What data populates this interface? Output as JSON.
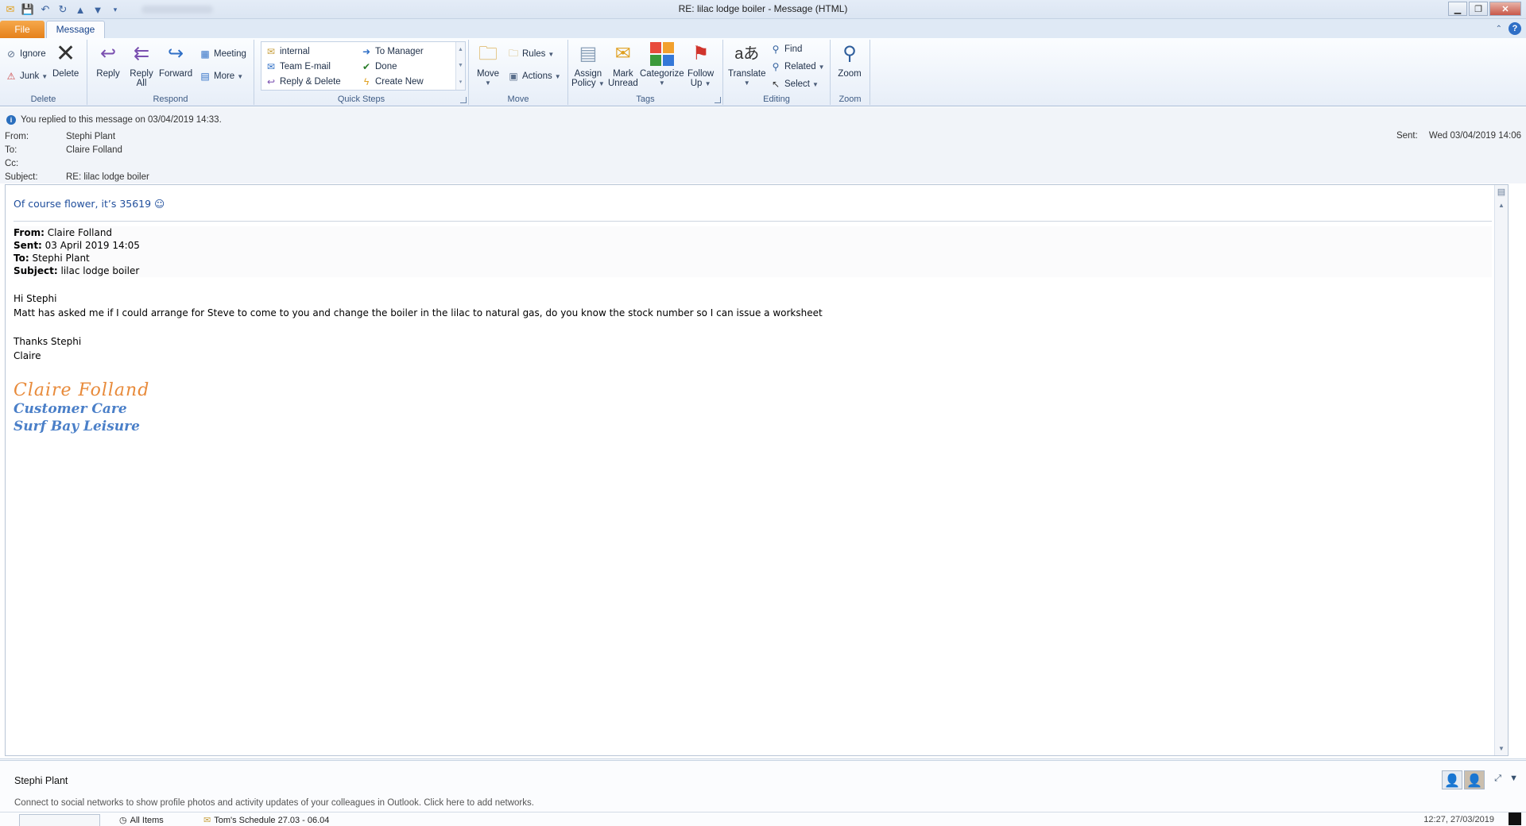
{
  "window": {
    "title": "RE: lilac lodge boiler  -  Message (HTML)"
  },
  "tabs": {
    "file": "File",
    "message": "Message"
  },
  "ribbon": {
    "delete_group": {
      "label": "Delete",
      "ignore": "Ignore",
      "junk": "Junk",
      "delete": "Delete"
    },
    "respond_group": {
      "label": "Respond",
      "reply": "Reply",
      "reply_all_1": "Reply",
      "reply_all_2": "All",
      "forward": "Forward",
      "meeting": "Meeting",
      "more": "More"
    },
    "quick_steps": {
      "label": "Quick Steps",
      "items": [
        "internal",
        "Team E-mail",
        "Reply & Delete",
        "To Manager",
        "Done",
        "Create New"
      ]
    },
    "move_group": {
      "label": "Move",
      "move": "Move",
      "rules": "Rules",
      "actions": "Actions"
    },
    "tags_group": {
      "label": "Tags",
      "assign_1": "Assign",
      "assign_2": "Policy",
      "mark_1": "Mark",
      "mark_2": "Unread",
      "categorize": "Categorize",
      "follow_1": "Follow",
      "follow_2": "Up"
    },
    "editing_group": {
      "label": "Editing",
      "translate": "Translate",
      "find": "Find",
      "related": "Related",
      "select": "Select"
    },
    "zoom_group": {
      "label": "Zoom",
      "zoom": "Zoom"
    }
  },
  "info": {
    "notice": "You replied to this message on 03/04/2019 14:33.",
    "from_label": "From:",
    "from": "Stephi Plant",
    "to_label": "To:",
    "to": "Claire Folland",
    "cc_label": "Cc:",
    "cc": "",
    "subject_label": "Subject:",
    "subject": "RE: lilac lodge boiler",
    "sent_label": "Sent:",
    "sent": "Wed 03/04/2019 14:06"
  },
  "body": {
    "reply_text": "Of course flower, it’s 35619 ☺",
    "quoted": {
      "from_label": "From:",
      "from": " Claire Folland",
      "sent_label": "Sent:",
      "sent": " 03 April 2019 14:05",
      "to_label": "To:",
      "to": " Stephi Plant",
      "subject_label": "Subject:",
      "subject": " lilac lodge boiler"
    },
    "greeting": "Hi Stephi",
    "message": "Matt has asked me if I could arrange for Steve to come to you and change the boiler in the lilac to natural gas, do you know the stock number so I can issue a worksheet",
    "thanks": "Thanks Stephi",
    "name": "Claire",
    "signature": {
      "script_name": "Claire Folland",
      "dept": "Customer Care",
      "company": "Surf Bay Leisure"
    }
  },
  "people_pane": {
    "name": "Stephi Plant",
    "connect_text": "Connect to social networks to show profile photos and activity updates of your colleagues in Outlook. Click here to add networks.",
    "all_items": "All Items",
    "item_title": "Tom's Schedule 27.03 - 06.04",
    "item_time": "12:27, 27/03/2019"
  },
  "colors": {
    "file_tab": "#e5811a",
    "accent_blue": "#1f4e9c",
    "signature_orange": "#e88a3a",
    "signature_blue": "#4a7fc8"
  }
}
